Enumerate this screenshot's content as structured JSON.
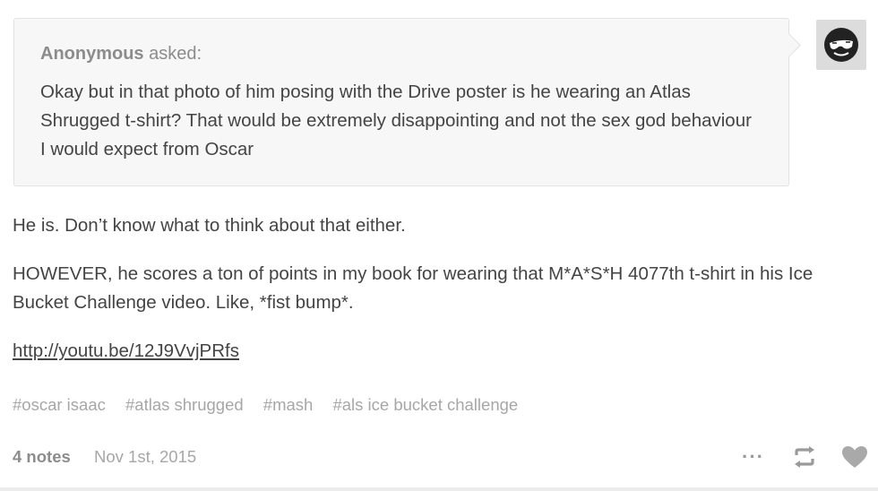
{
  "ask": {
    "asker": "Anonymous",
    "asked_label": "asked:",
    "question": "Okay but in that photo of him posing with the Drive poster is he wearing an Atlas Shrugged t-shirt? That would be extremely disappointing and not the sex god behaviour I would expect from Oscar"
  },
  "avatar": {
    "icon": "sunglasses-face-icon"
  },
  "answer": {
    "paragraph1": "He is. Don’t know what to think about that either.",
    "paragraph2": "HOWEVER, he scores a ton of points in my book for wearing that M*A*S*H 4077th t-shirt in his Ice Bucket Challenge video. Like, *fist bump*.",
    "link": "http://youtu.be/12J9VvjPRfs"
  },
  "tags": [
    "#oscar isaac",
    "#atlas shrugged",
    "#mash",
    "#als ice bucket challenge"
  ],
  "footer": {
    "notes": "4 notes",
    "date": "Nov 1st, 2015",
    "icons": [
      "more-icon",
      "reblog-icon",
      "like-icon"
    ]
  }
}
